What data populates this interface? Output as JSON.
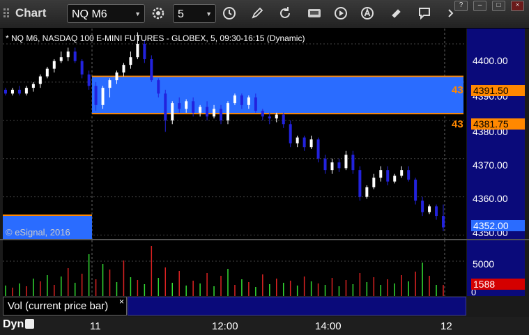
{
  "window": {
    "app_title": "Chart",
    "symbol": "NQ M6",
    "interval": "5",
    "window_buttons": [
      "?",
      "–",
      "□",
      "×"
    ]
  },
  "chart": {
    "title": "* NQ M6, NASDAQ 100 E-MINI FUTURES - GLOBEX, 5, 09:30-16:15 (Dynamic)",
    "watermark": "© eSignal, 2016",
    "price_ticks": [
      "4400.00",
      "4390.00",
      "4380.00",
      "4370.00",
      "4360.00",
      "4350.00"
    ],
    "upper_line_label": "4391.50",
    "lower_line_label": "4381.75",
    "upper_line_short": "43",
    "lower_line_short": "43",
    "last_price": "4352.00",
    "colors": {
      "up_candle": "#ffffff",
      "down_candle": "#2222dd",
      "zone": "#2a6cff",
      "level_line": "#ff8800",
      "axis_bg": "#0a0a7a"
    }
  },
  "volume": {
    "pane_label": "Vol (current price bar)",
    "close_glyph": "×",
    "axis_tick": "5000",
    "axis_zero": "0",
    "last_volume": "1588"
  },
  "xaxis": {
    "mode_label": "Dyn",
    "ticks": [
      "11",
      "12:00",
      "14:00",
      "12"
    ]
  },
  "chart_data": {
    "type": "candlestick",
    "ylim": [
      4349,
      4404
    ],
    "levels": [
      4391.5,
      4381.75
    ],
    "last_price": 4352.0,
    "candles": [
      [
        4388,
        4388.5,
        4386.5,
        4387,
        0
      ],
      [
        4387,
        4388.5,
        4386.5,
        4388,
        1
      ],
      [
        4388,
        4389,
        4386.5,
        4387,
        0
      ],
      [
        4387,
        4389,
        4386.5,
        4388.5,
        1
      ],
      [
        4388.5,
        4390,
        4387.5,
        4389.5,
        1
      ],
      [
        4389.5,
        4392,
        4388.5,
        4391.5,
        1
      ],
      [
        4391.5,
        4394,
        4391,
        4393.5,
        1
      ],
      [
        4393.5,
        4396,
        4392.5,
        4395.5,
        1
      ],
      [
        4395.5,
        4398,
        4395,
        4396.5,
        1
      ],
      [
        4396.5,
        4399,
        4395.5,
        4398,
        1
      ],
      [
        4398,
        4399,
        4395,
        4395.5,
        0
      ],
      [
        4395.5,
        4396,
        4391,
        4392,
        0
      ],
      [
        4392,
        4393,
        4388,
        4389,
        0
      ],
      [
        4389,
        4390,
        4382.5,
        4384,
        0
      ],
      [
        4384,
        4389,
        4383,
        4388.5,
        1
      ],
      [
        4388.5,
        4391,
        4386,
        4390.5,
        1
      ],
      [
        4390.5,
        4393,
        4389.5,
        4392.5,
        1
      ],
      [
        4392.5,
        4395,
        4391.5,
        4394.5,
        1
      ],
      [
        4394.5,
        4398,
        4393.5,
        4396.5,
        1
      ],
      [
        4396.5,
        4403,
        4396,
        4400,
        1
      ],
      [
        4400,
        4401,
        4395,
        4396,
        0
      ],
      [
        4396,
        4397,
        4390,
        4390.5,
        0
      ],
      [
        4390.5,
        4391,
        4386,
        4387,
        0
      ],
      [
        4387,
        4388,
        4377,
        4380,
        0
      ],
      [
        4380,
        4385,
        4379,
        4384.5,
        1
      ],
      [
        4384.5,
        4386,
        4382,
        4383,
        0
      ],
      [
        4383,
        4385.5,
        4382,
        4385,
        1
      ],
      [
        4385,
        4386,
        4381,
        4382,
        0
      ],
      [
        4382,
        4384,
        4381,
        4383.5,
        1
      ],
      [
        4383.5,
        4385,
        4380,
        4381,
        0
      ],
      [
        4381,
        4384,
        4380.5,
        4383,
        1
      ],
      [
        4383,
        4384,
        4379,
        4380,
        0
      ],
      [
        4380,
        4385,
        4379,
        4384.5,
        1
      ],
      [
        4384.5,
        4387,
        4384,
        4386.5,
        1
      ],
      [
        4386.5,
        4387,
        4383,
        4384,
        0
      ],
      [
        4384,
        4386.5,
        4383,
        4386,
        1
      ],
      [
        4386,
        4387,
        4382,
        4382.5,
        0
      ],
      [
        4382.5,
        4383,
        4380,
        4381,
        0
      ],
      [
        4381,
        4382,
        4379,
        4380.5,
        0
      ],
      [
        4380.5,
        4382,
        4379.5,
        4381.5,
        1
      ],
      [
        4381.5,
        4382,
        4378,
        4379,
        0
      ],
      [
        4379,
        4380,
        4373,
        4374,
        0
      ],
      [
        4374,
        4376,
        4373,
        4375.5,
        1
      ],
      [
        4375.5,
        4376,
        4372,
        4373,
        0
      ],
      [
        4373,
        4376,
        4372.5,
        4375,
        1
      ],
      [
        4375,
        4375.5,
        4369,
        4370,
        0
      ],
      [
        4370,
        4371,
        4366,
        4367,
        0
      ],
      [
        4367,
        4370,
        4366,
        4369,
        1
      ],
      [
        4369,
        4370,
        4366.5,
        4367.5,
        0
      ],
      [
        4367.5,
        4372,
        4367,
        4371,
        1
      ],
      [
        4371,
        4372,
        4366,
        4367,
        0
      ],
      [
        4367,
        4368,
        4359,
        4360,
        0
      ],
      [
        4360,
        4363,
        4359.5,
        4362.5,
        1
      ],
      [
        4362.5,
        4366,
        4362,
        4365,
        1
      ],
      [
        4365,
        4368,
        4364,
        4367,
        1
      ],
      [
        4367,
        4368,
        4363,
        4364,
        0
      ],
      [
        4364,
        4366,
        4363.5,
        4365.5,
        1
      ],
      [
        4365.5,
        4368,
        4365,
        4367,
        1
      ],
      [
        4367,
        4368,
        4364,
        4364.5,
        0
      ],
      [
        4364.5,
        4365,
        4358,
        4359,
        0
      ],
      [
        4359,
        4360,
        4355,
        4356,
        0
      ],
      [
        4356,
        4358,
        4355.5,
        4357.5,
        1
      ],
      [
        4357.5,
        4358,
        4354,
        4355,
        0
      ],
      [
        4355,
        4358,
        4351,
        4352,
        0
      ]
    ],
    "volume": [
      [
        1500,
        1
      ],
      [
        1200,
        0
      ],
      [
        1800,
        1
      ],
      [
        1400,
        0
      ],
      [
        2500,
        1
      ],
      [
        2100,
        0
      ],
      [
        3000,
        1
      ],
      [
        1600,
        0
      ],
      [
        2800,
        1
      ],
      [
        4000,
        0
      ],
      [
        1900,
        1
      ],
      [
        3200,
        0
      ],
      [
        6000,
        1
      ],
      [
        2400,
        0
      ],
      [
        4600,
        1
      ],
      [
        3800,
        0
      ],
      [
        2000,
        1
      ],
      [
        5100,
        0
      ],
      [
        2700,
        1
      ],
      [
        2300,
        0
      ],
      [
        1700,
        1
      ],
      [
        7200,
        0
      ],
      [
        2600,
        1
      ],
      [
        4100,
        0
      ],
      [
        1900,
        1
      ],
      [
        3600,
        0
      ],
      [
        1500,
        1
      ],
      [
        2200,
        0
      ],
      [
        1800,
        1
      ],
      [
        3300,
        0
      ],
      [
        1400,
        1
      ],
      [
        2900,
        0
      ],
      [
        3900,
        1
      ],
      [
        1600,
        0
      ],
      [
        2400,
        1
      ],
      [
        2000,
        0
      ],
      [
        1300,
        1
      ],
      [
        3100,
        0
      ],
      [
        1700,
        1
      ],
      [
        2500,
        0
      ],
      [
        1900,
        1
      ],
      [
        2200,
        0
      ],
      [
        1500,
        1
      ],
      [
        2800,
        0
      ],
      [
        2100,
        1
      ],
      [
        1800,
        0
      ],
      [
        1600,
        1
      ],
      [
        2600,
        0
      ],
      [
        1400,
        1
      ],
      [
        2300,
        0
      ],
      [
        1700,
        1
      ],
      [
        3300,
        0
      ],
      [
        2000,
        1
      ],
      [
        2700,
        0
      ],
      [
        1600,
        1
      ],
      [
        2400,
        0
      ],
      [
        1800,
        1
      ],
      [
        3000,
        0
      ],
      [
        2100,
        1
      ],
      [
        3500,
        0
      ],
      [
        4800,
        1
      ],
      [
        2900,
        0
      ],
      [
        1600,
        1
      ],
      [
        1588,
        0
      ]
    ]
  }
}
